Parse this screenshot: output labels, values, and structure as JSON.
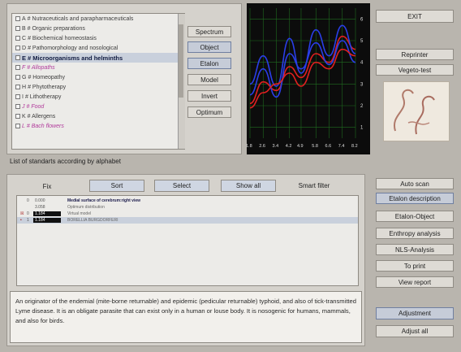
{
  "categories": [
    {
      "letter": "A",
      "label": "# Nutraceuticals and parapharmaceuticals",
      "style": "normal"
    },
    {
      "letter": "B",
      "label": "# Organic preparations",
      "style": "normal"
    },
    {
      "letter": "C",
      "label": "# Biochemical homeostasis",
      "style": "normal"
    },
    {
      "letter": "D",
      "label": "# Pathomorphology and nosological",
      "style": "normal"
    },
    {
      "letter": "E",
      "label": "# Microorganisms and helminths",
      "style": "active"
    },
    {
      "letter": "F",
      "label": "# Allopaths",
      "style": "pink"
    },
    {
      "letter": "G",
      "label": "# Homeopathy",
      "style": "normal"
    },
    {
      "letter": "H",
      "label": "# Phytotherapy",
      "style": "normal"
    },
    {
      "letter": "I",
      "label": "# Lithotherapy",
      "style": "normal"
    },
    {
      "letter": "J",
      "label": "# Food",
      "style": "pink"
    },
    {
      "letter": "K",
      "label": "# Allergens",
      "style": "normal"
    },
    {
      "letter": "L",
      "label": "# Bach flowers",
      "style": "pink"
    }
  ],
  "side_buttons": [
    "Spectrum",
    "Object",
    "Etalon",
    "Model",
    "Invert",
    "Optimum"
  ],
  "chart_data": {
    "type": "line",
    "x": [
      1.8,
      2.6,
      3.4,
      4.2,
      4.9,
      5.8,
      6.6,
      7.4,
      8.2
    ],
    "ytick_labels": [
      "1",
      "2",
      "3",
      "4",
      "5",
      "6"
    ],
    "xtick_labels": [
      "1.8",
      "2.6",
      "3.4",
      "4.2",
      "4.9",
      "5.8",
      "6.6",
      "7.4",
      "8.2"
    ],
    "ylim": [
      0.5,
      6.5
    ],
    "grid": true,
    "series": [
      {
        "color": "#e02020",
        "values": [
          2.1,
          3.1,
          2.7,
          3.8,
          3.3,
          4.4,
          4.0,
          5.2,
          4.6
        ]
      },
      {
        "color": "#2a3ee8",
        "values": [
          3.0,
          4.3,
          2.9,
          5.1,
          3.5,
          5.5,
          4.3,
          5.7,
          4.4
        ]
      },
      {
        "color": "#2a3ee8",
        "values": [
          2.5,
          3.7,
          2.4,
          4.4,
          3.7,
          4.9,
          3.9,
          5.0,
          4.0
        ]
      },
      {
        "color": "#e02020",
        "values": [
          1.9,
          2.6,
          3.0,
          3.5,
          2.9,
          4.0,
          3.7,
          4.6,
          4.3
        ]
      }
    ]
  },
  "right_top_buttons": [
    "EXIT",
    "Reprinter",
    "Vegeto-test"
  ],
  "list_title": "List of standarts according by alphabet",
  "toolbar": {
    "fix": "Fix",
    "sort": "Sort",
    "select": "Select",
    "show_all": "Show all",
    "smart_filter": "Smart filter"
  },
  "standards": [
    {
      "mark": "",
      "num": "0",
      "value": "0.000",
      "label": "Medial surface of cerebrum:right view",
      "bold": true
    },
    {
      "mark": "",
      "num": "",
      "value": "3.058",
      "label": "Optimum distribution",
      "bold": false
    },
    {
      "mark": "☒",
      "num": "0",
      "value": "1.184",
      "label": "Virtual model",
      "bold": false
    },
    {
      "mark": "•",
      "num": "1",
      "value": "1.184",
      "label": "BORELLIA BURGDORFERI",
      "bold": false
    }
  ],
  "right_buttons": [
    "Auto scan",
    "Etalon description",
    "Etalon-Object",
    "Enthropy analysis",
    "NLS-Analysis",
    "To print",
    "View report"
  ],
  "bottom_buttons": [
    "Adjustment",
    "Adjust all"
  ],
  "description": "An originator of the endemial (mite-borne returnable) and epidemic (pedicular returnable)  typhoid, and also of  tick-transmitted Lyme disease. It is an obligate parasite that can exist only in a human or louse body. It is nosogenic for humans, mammals, and also for birds."
}
